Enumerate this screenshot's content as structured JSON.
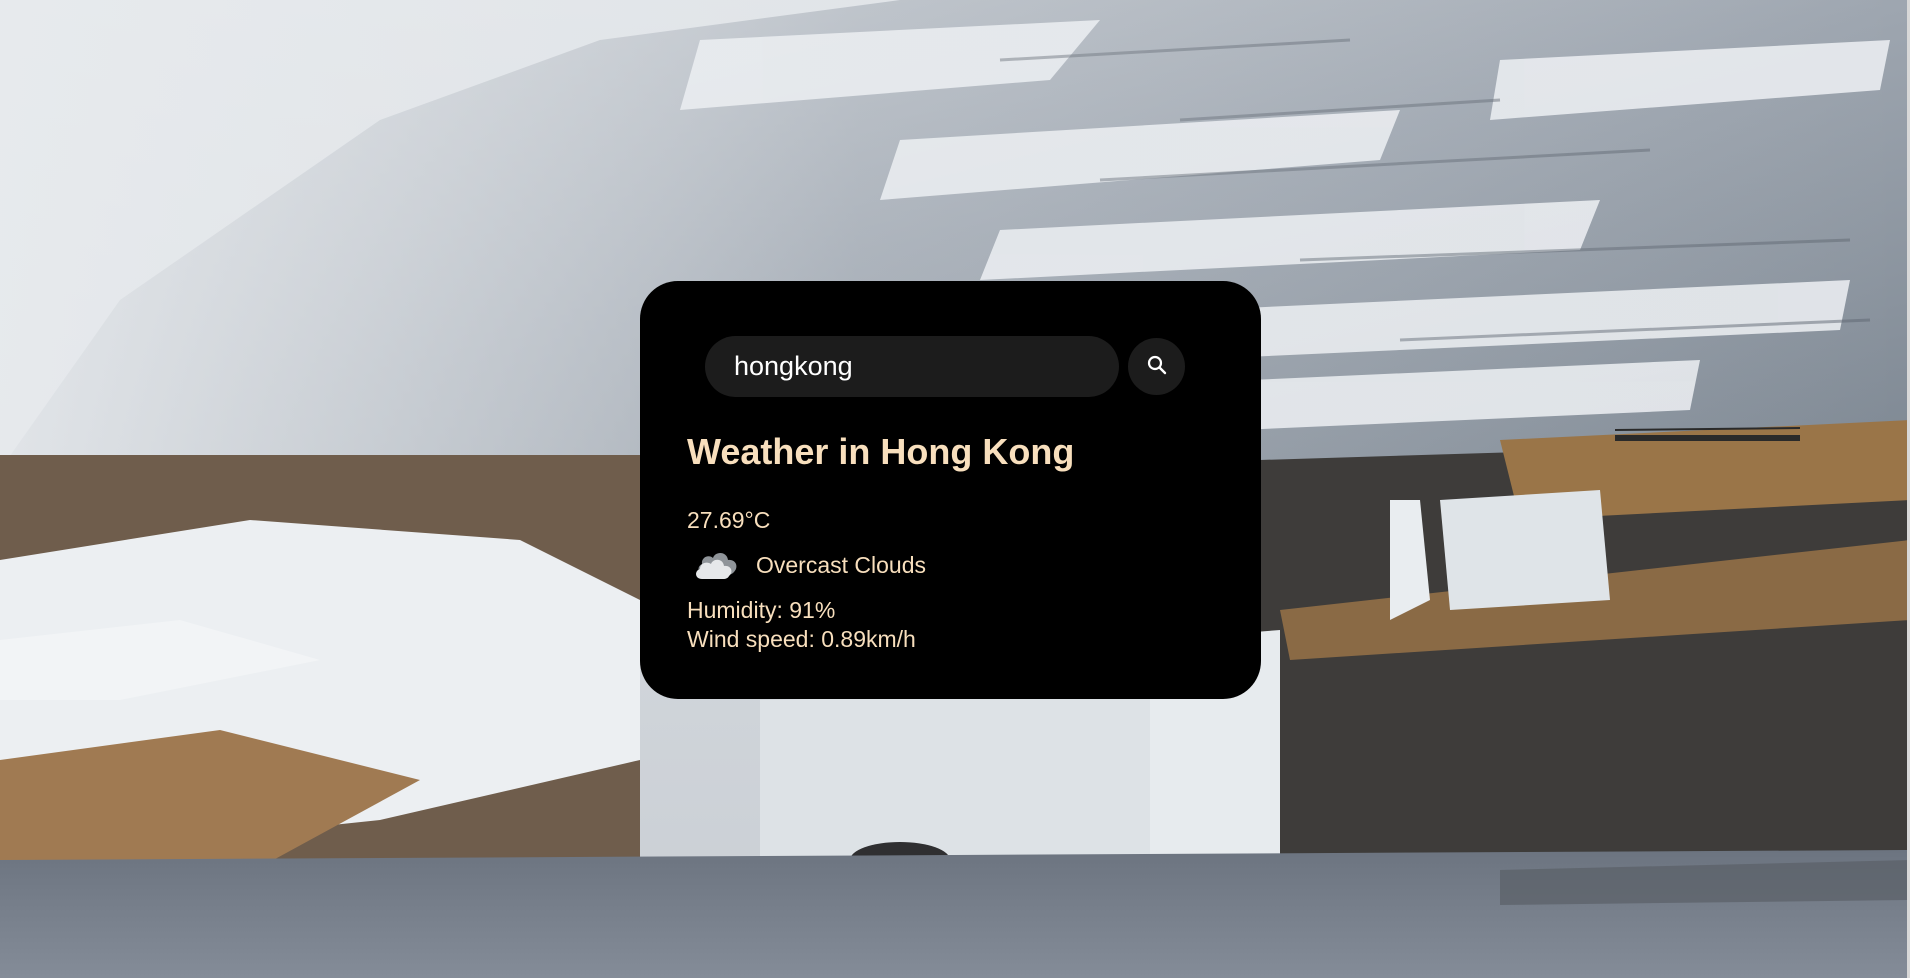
{
  "search": {
    "value": "hongkong",
    "placeholder": ""
  },
  "weather": {
    "title": "Weather in Hong Kong",
    "temperature": "27.69°C",
    "condition_icon": "cloud-icon",
    "description": "Overcast Clouds",
    "humidity": "Humidity: 91%",
    "wind": "Wind speed: 0.89km/h"
  },
  "colors": {
    "card_background": "#000000",
    "text_accent": "#f8dfbd",
    "input_background": "#1c1c1c"
  },
  "icons": {
    "search_button": "search-icon",
    "condition": "cloud-icon"
  }
}
